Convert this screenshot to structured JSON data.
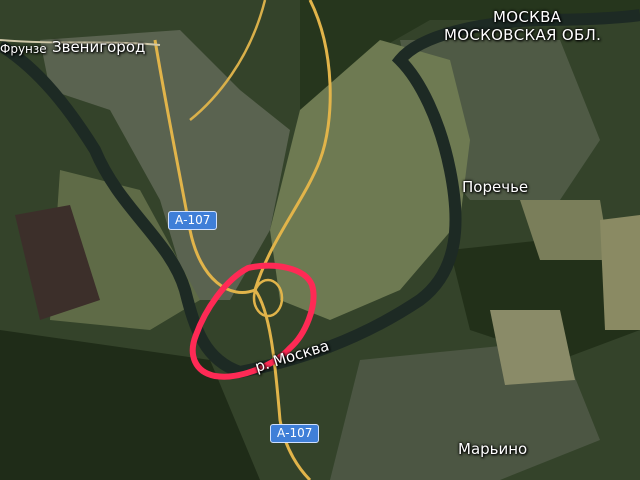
{
  "map": {
    "type": "satellite",
    "labels": {
      "zvenigorod": "Звенигород",
      "frunze": "Фрунзе",
      "moskva": "МОСКВА",
      "moskovskaya_obl": "МОСКОВСКАЯ ОБЛ.",
      "porechye": "Поречье",
      "marino": "Марьино",
      "river_moskva": "р. Москва"
    },
    "roads": [
      {
        "name": "A-107",
        "label": "А-107"
      },
      {
        "name": "A-107",
        "label": "А-107"
      }
    ],
    "annotation": {
      "shape": "freehand-circle",
      "color": "#ff2a55"
    }
  }
}
